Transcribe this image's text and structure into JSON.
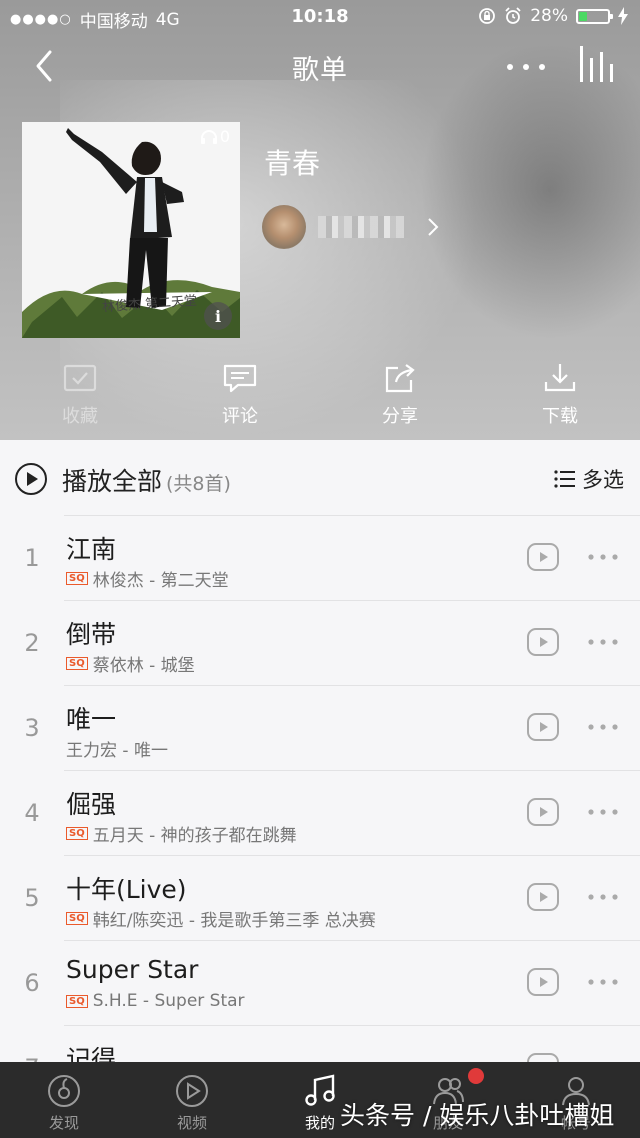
{
  "status_bar": {
    "carrier": "中国移动",
    "network": "4G",
    "time": "10:18",
    "battery": "28%",
    "battery_level": 0.28
  },
  "nav": {
    "title": "歌单"
  },
  "playlist": {
    "name": "青春",
    "play_count": "0",
    "album_art_text": "林俊杰 第二天堂"
  },
  "actions": [
    {
      "label": "收藏"
    },
    {
      "label": "评论"
    },
    {
      "label": "分享"
    },
    {
      "label": "下载"
    }
  ],
  "play_all": {
    "label": "播放全部",
    "count": "(共8首)",
    "multi_select": "多选"
  },
  "songs": [
    {
      "index": "1",
      "title": "江南",
      "sq": "SQ",
      "artist_album": "林俊杰 - 第二天堂"
    },
    {
      "index": "2",
      "title": "倒带",
      "sq": "SQ",
      "artist_album": "蔡依林 - 城堡"
    },
    {
      "index": "3",
      "title": "唯一",
      "sq": "",
      "artist_album": "王力宏 - 唯一"
    },
    {
      "index": "4",
      "title": "倔强",
      "sq": "SQ",
      "artist_album": "五月天 - 神的孩子都在跳舞"
    },
    {
      "index": "5",
      "title": "十年(Live)",
      "sq": "SQ",
      "artist_album": "韩红/陈奕迅 - 我是歌手第三季 总决赛"
    },
    {
      "index": "6",
      "title": "Super Star",
      "sq": "SQ",
      "artist_album": "S.H.E - Super Star"
    },
    {
      "index": "7",
      "title": "记得",
      "sq": "",
      "artist_album": ""
    }
  ],
  "tabs": [
    {
      "label": "发现"
    },
    {
      "label": "视频"
    },
    {
      "label": "我的"
    },
    {
      "label": "朋友"
    },
    {
      "label": "帐号"
    }
  ],
  "watermark": "头条号 / 娱乐八卦吐槽姐",
  "colors": {
    "accent_red": "#e03a3a",
    "sq_orange": "#ea5a2c",
    "tabbar_bg": "#2b2b2b"
  }
}
